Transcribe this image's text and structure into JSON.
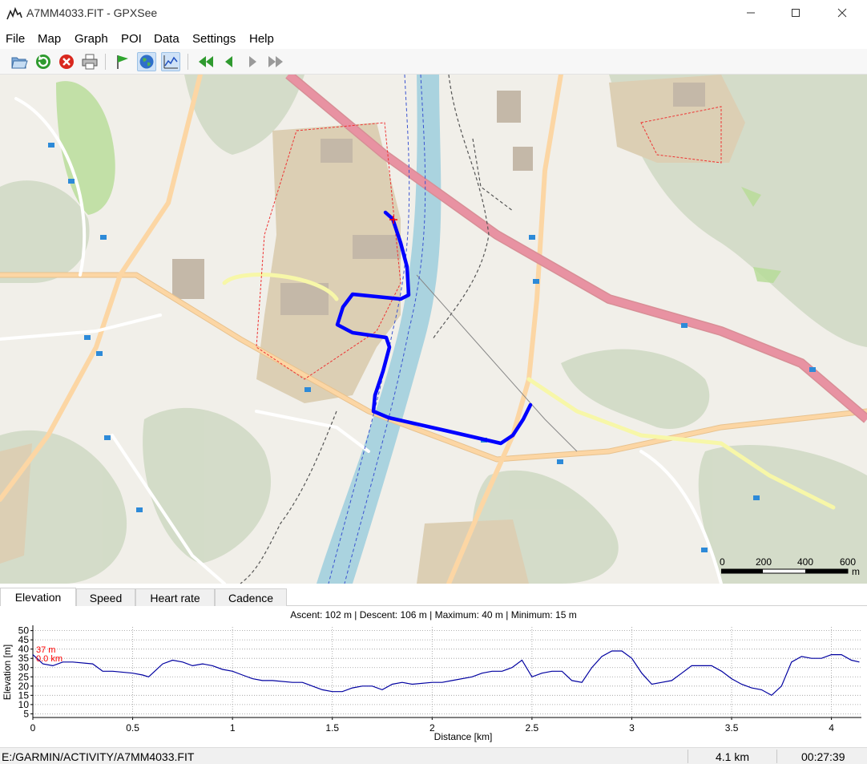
{
  "window": {
    "title": "A7MM4033.FIT - GPXSee"
  },
  "menu": [
    "File",
    "Map",
    "Graph",
    "POI",
    "Data",
    "Settings",
    "Help"
  ],
  "toolbar": {
    "icons": [
      "open-file-icon",
      "reload-icon",
      "close-file-icon",
      "print-icon",
      "show-poi-flag-icon",
      "show-map-globe-icon",
      "show-graphs-icon",
      "first-file-icon",
      "previous-file-icon",
      "next-file-icon",
      "last-file-icon"
    ]
  },
  "map": {
    "track_color": "#0000ff",
    "scale": {
      "labels": [
        "0",
        "200",
        "400",
        "600"
      ],
      "unit": "m"
    }
  },
  "tabs": [
    "Elevation",
    "Speed",
    "Heart rate",
    "Cadence"
  ],
  "graph": {
    "stats": "Ascent: 102 m | Descent: 106 m | Maximum: 40 m | Minimum: 15 m",
    "marker": {
      "value": "37 m",
      "distance": "0.0 km",
      "color": "#ff0000"
    }
  },
  "chart_data": {
    "type": "line",
    "xlabel": "Distance [km]",
    "ylabel": "Elevation [m]",
    "xlim": [
      0,
      4.15
    ],
    "ylim": [
      3,
      52
    ],
    "xticks": [
      0,
      0.5,
      1,
      1.5,
      2,
      2.5,
      3,
      3.5,
      4
    ],
    "xtick_labels": [
      "0",
      "0.5",
      "1",
      "1.5",
      "2",
      "2.5",
      "3",
      "3.5",
      "4"
    ],
    "yticks": [
      5,
      10,
      15,
      20,
      25,
      30,
      35,
      40,
      45,
      50
    ],
    "grid": true,
    "line_color": "#0000a0",
    "series": [
      {
        "x": [
          0.0,
          0.05,
          0.1,
          0.15,
          0.2,
          0.3,
          0.35,
          0.4,
          0.5,
          0.55,
          0.58,
          0.6,
          0.65,
          0.7,
          0.75,
          0.8,
          0.85,
          0.9,
          0.95,
          1.0,
          1.05,
          1.1,
          1.15,
          1.2,
          1.3,
          1.35,
          1.4,
          1.45,
          1.5,
          1.55,
          1.6,
          1.65,
          1.7,
          1.75,
          1.8,
          1.85,
          1.9,
          2.0,
          2.05,
          2.1,
          2.2,
          2.25,
          2.3,
          2.35,
          2.4,
          2.45,
          2.5,
          2.55,
          2.6,
          2.65,
          2.7,
          2.75,
          2.8,
          2.85,
          2.9,
          2.95,
          3.0,
          3.05,
          3.1,
          3.15,
          3.2,
          3.25,
          3.3,
          3.35,
          3.4,
          3.45,
          3.5,
          3.55,
          3.6,
          3.65,
          3.7,
          3.75,
          3.8,
          3.85,
          3.9,
          3.95,
          4.0,
          4.05,
          4.1,
          4.14
        ],
        "y": [
          37,
          32,
          31,
          33,
          33,
          32,
          28,
          28,
          27,
          26,
          25,
          27,
          32,
          34,
          33,
          31,
          32,
          31,
          29,
          28,
          26,
          24,
          23,
          23,
          22,
          22,
          20,
          18,
          17,
          17,
          19,
          20,
          20,
          18,
          21,
          22,
          21,
          22,
          22,
          23,
          25,
          27,
          28,
          28,
          30,
          34,
          25,
          27,
          28,
          28,
          23,
          22,
          30,
          36,
          39,
          39,
          35,
          27,
          21,
          22,
          23,
          27,
          31,
          31,
          31,
          28,
          24,
          21,
          19,
          18,
          15,
          20,
          33,
          36,
          35,
          35,
          37,
          37,
          34,
          33
        ]
      }
    ]
  },
  "status": {
    "path": "E:/GARMIN/ACTIVITY/A7MM4033.FIT",
    "distance": "4.1 km",
    "time": "00:27:39"
  }
}
